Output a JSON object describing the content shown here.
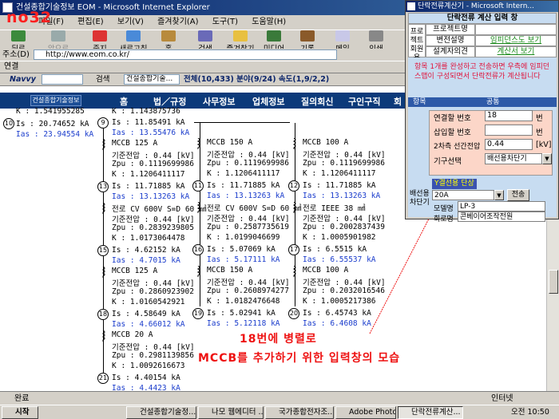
{
  "window": {
    "title": "건설종합기술정보 EOM - Microsoft Internet Explorer",
    "label": "no32"
  },
  "menu": [
    "파일(F)",
    "편집(E)",
    "보기(V)",
    "즐겨찾기(A)",
    "도구(T)",
    "도움말(H)"
  ],
  "toolbar": [
    "뒤로",
    "앞으로",
    "중지",
    "새로고침",
    "홈",
    "검색",
    "즐겨찾기",
    "미디어",
    "기록",
    "메일",
    "인쇄"
  ],
  "address": {
    "label": "주소(D)",
    "url": "http://www.eom.co.kr/"
  },
  "links": {
    "label": "연결"
  },
  "navvy": {
    "brand": "Navvy",
    "search_label": "검색",
    "site": "건설종합기술...",
    "stats": "전체(10,433) 분야(9/24) 속도(1,9/2,2)"
  },
  "site_nav": {
    "logo": "건설종합기술정보",
    "items": [
      "홈",
      "법／규정",
      "사무정보",
      "업체정보",
      "질의회신",
      "구인구직",
      "회"
    ]
  },
  "diagram": {
    "col1": [
      {
        "k": "K : 1.541955285"
      },
      {
        "node": "10",
        "is": "Is : 20.74652 kA",
        "ias": "Ias : 23.94554 kA"
      }
    ],
    "col2_top": {
      "k": "K : 1.143875736"
    },
    "col2": [
      {
        "node": "9",
        "is": "Is : 11.85491 kA",
        "ias": "Ias : 13.55476 kA",
        "dev": "MCCB 125 A",
        "v": "기준전압 : 0.44 [kV]",
        "z": "Zpu : 0.1119699986",
        "k": "K : 1.1206411117"
      },
      {
        "node": "13",
        "is": "Is : 11.71885 kA",
        "ias": "Ias : 13.13263 kA",
        "dev": "전로 CV 600V S=D 60 ㎟",
        "v": "기준전압 : 0.44 [kV]",
        "z": "Zpu : 0.2839239805",
        "k": "K : 1.0173064478"
      },
      {
        "node": "15",
        "is": "Is : 4.62152 kA",
        "ias": "Ias : 4.7015 kA",
        "dev": "MCCB 125 A",
        "v": "기준전압 : 0.44 [kV]",
        "z": "Zpu : 0.2860923902",
        "k": "K : 1.0160542921"
      },
      {
        "node": "18",
        "is": "Is : 4.58649 kA",
        "ias": "Ias : 4.66012 kA",
        "dev": "MCCB 20 A",
        "v": "기준전압 : 0.44 [kV]",
        "z": "Zpu : 0.2981139856",
        "k": "K : 1.0092616673"
      },
      {
        "node": "21",
        "is": "Is : 4.40154 kA",
        "ias": "Ias : 4.4423 kA"
      }
    ],
    "col3": [
      {
        "dev": "MCCB 150 A",
        "v": "기준전압 : 0.44 [kV]",
        "z": "Zpu : 0.1119699986",
        "k": "K : 1.1206411117"
      },
      {
        "node": "11",
        "is": "Is : 11.71885 kA",
        "ias": "Ias : 13.13263 kA",
        "dev": "전로 CV 600V S=D 60 ㎟",
        "v": "기준전압 : 0.44 [kV]",
        "z": "Zpu : 0.2587735619",
        "k": "K : 1.0199046699"
      },
      {
        "node": "16",
        "is": "Is : 5.07069 kA",
        "ias": "Ias : 5.17111 kA",
        "dev": "MCCB 150 A",
        "v": "기준전압 : 0.44 [kV]",
        "z": "Zpu : 0.2608974277",
        "k": "K : 1.0182476648"
      },
      {
        "node": "19",
        "is": "Is : 5.02941 kA",
        "ias": "Ias : 5.12118 kA"
      }
    ],
    "col4": [
      {
        "dev": "MCCB 100 A",
        "v": "기준전압 : 0.44 [kV]",
        "z": "Zpu : 0.1119699986",
        "k": "K : 1.1206411117"
      },
      {
        "node": "12",
        "is": "Is : 11.71885 kA",
        "ias": "Ias : 13.13263 kA",
        "dev": "전로 IEEE 38 ㎟",
        "v": "기준전압 : 0.44 [kV]",
        "z": "Zpu : 0.2002837439",
        "k": "K : 1.0005901982"
      },
      {
        "node": "17",
        "is": "Is : 6.5515 kA",
        "ias": "Ias : 6.55537 kA",
        "dev": "MCCB 100 A",
        "v": "기준전압 : 0.44 [kV]",
        "z": "Zpu : 0.2032016546",
        "k": "K : 1.0005217386"
      },
      {
        "node": "20",
        "is": "Is : 6.45743 kA",
        "ias": "Ias : 6.4608 kA"
      }
    ]
  },
  "annotation": {
    "line1": "18번에 병렬로",
    "line2": "MCCB를 추가하기 위한 입력창의 모습"
  },
  "popup": {
    "title": "단락전류계산기 - Microsoft Intern...",
    "heading": "단락전류 계산 입력 창",
    "side_label": "프로젝트회원용",
    "rows": [
      {
        "label": "프로젝트명",
        "value": ""
      },
      {
        "label": "변전설명",
        "value": "임피던스도 보기"
      },
      {
        "label": "설계자의견",
        "value": "계산서 보기"
      }
    ],
    "notice": "항목 1개를 완성하고 전송하면 우측에 임피던스맵이 구성되면서 단락전류가 계산됩니다",
    "header": {
      "left": "항목",
      "right": "공통"
    },
    "fields": [
      {
        "label": "연결할 번호",
        "value": "18",
        "unit": "번"
      },
      {
        "label": "삽입할 번호",
        "value": "",
        "unit": "번"
      },
      {
        "label": "2차측 선간전압",
        "value": "0.44",
        "unit": "[kV]"
      },
      {
        "label": "기구선택",
        "value": "배선용차단기"
      }
    ],
    "breaker": {
      "label": "배선용차단기",
      "type": "Y결선용 단상",
      "rating": "20A",
      "send": "전송",
      "model_label": "모델명",
      "model_value": "LP-3",
      "maker_label": "회로명",
      "maker_value": "콘베이어조작전원"
    }
  },
  "status": {
    "left": "완료",
    "right": "인터넷"
  },
  "taskbar": {
    "start": "시작",
    "tasks": [
      "건설종합기술정...",
      "나모 웹에디터 ...",
      "국가종합전자조...",
      "Adobe Photos...",
      "단락전류계산..."
    ],
    "clock": "오전 10:50"
  }
}
